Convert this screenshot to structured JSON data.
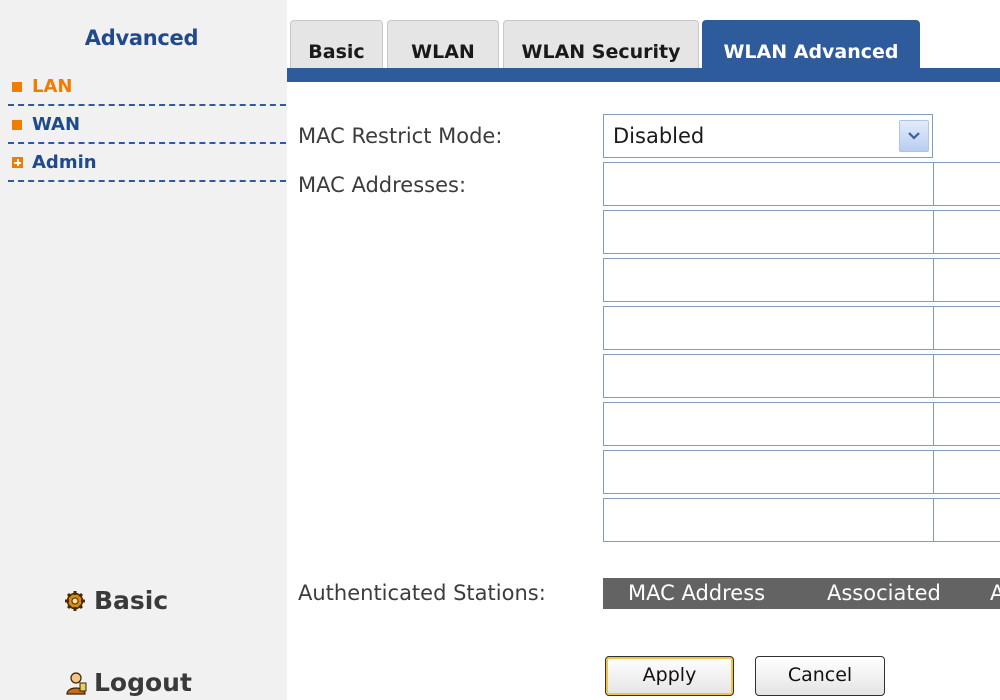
{
  "sidebar": {
    "title": "Advanced",
    "items": [
      {
        "label": "LAN",
        "icon": "square-bullet-icon"
      },
      {
        "label": "WAN",
        "icon": "square-bullet-icon"
      },
      {
        "label": "Admin",
        "icon": "plus-box-icon"
      }
    ],
    "links": [
      {
        "label": "Basic",
        "icon": "gear-icon"
      },
      {
        "label": "Logout",
        "icon": "person-icon"
      }
    ]
  },
  "tabs": [
    {
      "label": "Basic",
      "active": false
    },
    {
      "label": "WLAN",
      "active": false
    },
    {
      "label": "WLAN Security",
      "active": false
    },
    {
      "label": "WLAN Advanced",
      "active": true
    }
  ],
  "form": {
    "mac_restrict_mode_label": "MAC Restrict Mode:",
    "mac_restrict_mode_value": "Disabled",
    "mac_addresses_label": "MAC Addresses:",
    "mac_addresses": [
      "",
      "",
      "",
      "",
      "",
      "",
      "",
      "",
      "",
      "",
      "",
      "",
      "",
      "",
      "",
      ""
    ],
    "authenticated_stations_label": "Authenticated Stations:",
    "stations_columns": [
      "MAC Address",
      "Associated",
      "A"
    ]
  },
  "buttons": {
    "apply": "Apply",
    "cancel": "Cancel"
  },
  "colors": {
    "accent": "#2d5b9b",
    "active_nav": "#f07d00",
    "header_gray": "#636363"
  }
}
